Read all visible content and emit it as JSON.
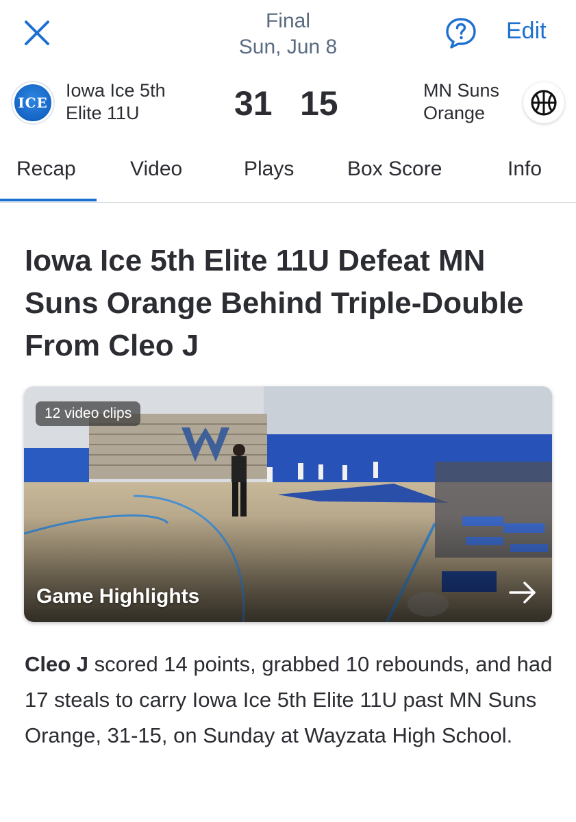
{
  "header": {
    "status": "Final",
    "date": "Sun, Jun 8",
    "edit_label": "Edit",
    "close_icon": "close-icon",
    "help_icon": "help-icon"
  },
  "scoreboard": {
    "home": {
      "name_line1": "Iowa Ice 5th",
      "name_line2": "Elite 11U",
      "score": "31",
      "logo_text": "ICE"
    },
    "away": {
      "name_line1": "MN Suns",
      "name_line2": "Orange",
      "score": "15",
      "logo_icon": "basketball-icon"
    }
  },
  "tabs": [
    {
      "label": "Recap",
      "active": true
    },
    {
      "label": "Video",
      "active": false
    },
    {
      "label": "Plays",
      "active": false
    },
    {
      "label": "Box Score",
      "active": false
    },
    {
      "label": "Info",
      "active": false
    }
  ],
  "article": {
    "headline": "Iowa Ice 5th Elite 11U Defeat MN Suns Orange Behind Triple-Double From Cleo J",
    "video": {
      "badge": "12 video clips",
      "title": "Game Highlights",
      "arrow_icon": "arrow-right-icon"
    },
    "summary_player": "Cleo J",
    "summary_text": " scored 14 points, grabbed 10 rebounds, and had 17 steals to carry Iowa Ice 5th Elite 11U past MN Suns Orange, 31-15, on Sunday at Wayzata High School."
  },
  "colors": {
    "accent": "#1d6fd1",
    "status_text": "#5b6b80",
    "body_text": "#2b2d33",
    "divider": "#d6d9de"
  }
}
